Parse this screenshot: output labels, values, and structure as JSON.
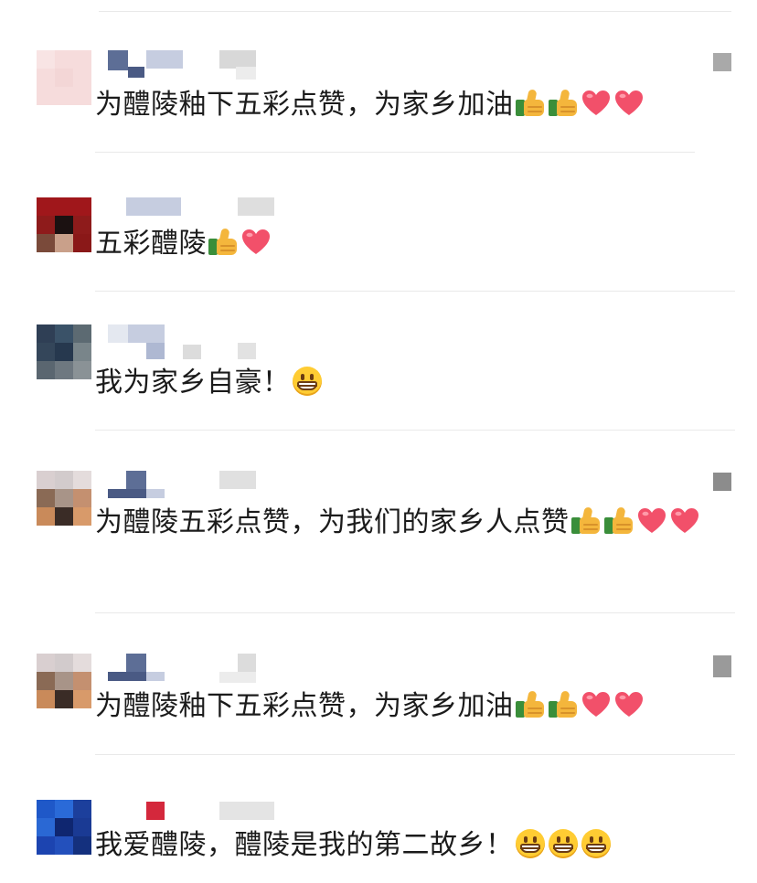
{
  "comments": [
    {
      "text_parts": [
        "为醴陵釉下五彩点赞，为家乡加油"
      ],
      "emojis": [
        "thumbs-up",
        "thumbs-up",
        "heart",
        "heart"
      ]
    },
    {
      "text_parts": [
        "五彩醴陵"
      ],
      "emojis": [
        "thumbs-up",
        "heart"
      ]
    },
    {
      "text_parts": [
        "我为家乡自豪！"
      ],
      "emojis": [
        "grinning-face"
      ]
    },
    {
      "text_parts": [
        "为醴陵五彩点赞，为我们的家乡人点赞"
      ],
      "emojis": [
        "thumbs-up",
        "thumbs-up",
        "heart",
        "heart"
      ]
    },
    {
      "text_parts": [
        "为醴陵釉下五彩点赞，为家乡加油"
      ],
      "emojis": [
        "thumbs-up",
        "thumbs-up",
        "heart",
        "heart"
      ]
    },
    {
      "text_parts": [
        "我爱醴陵，醴陵是我的第二故乡！"
      ],
      "emojis": [
        "grinning-face",
        "grinning-face",
        "grinning-face"
      ]
    }
  ],
  "colors": {
    "text": "#1b1b1b",
    "divider": "#e9e9e9",
    "like_marker": "#a9a9a9"
  }
}
